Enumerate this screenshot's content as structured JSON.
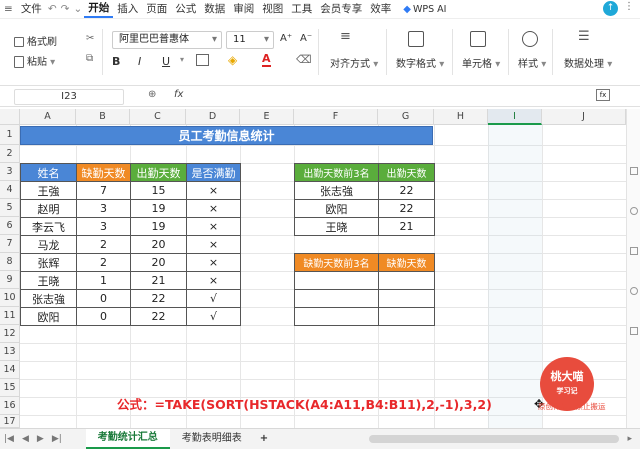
{
  "menu": {
    "file": "文件",
    "tabs": [
      "开始",
      "插入",
      "页面",
      "公式",
      "数据",
      "审阅",
      "视图",
      "工具",
      "会员专享",
      "效率"
    ],
    "wps_ai": "WPS AI"
  },
  "toolbar": {
    "format_painter": "格式刷",
    "paste": "粘贴",
    "font_name": "阿里巴巴普惠体",
    "font_size": "11",
    "bold": "B",
    "italic": "I",
    "underline": "U",
    "align": "对齐方式",
    "number_format": "数字格式",
    "cell": "单元格",
    "style": "样式",
    "data_process": "数据处理"
  },
  "formula_bar": {
    "cell_ref": "I23",
    "fx": "fx"
  },
  "columns": [
    "A",
    "B",
    "C",
    "D",
    "E",
    "F",
    "G",
    "H",
    "I",
    "J"
  ],
  "rows": [
    "1",
    "2",
    "3",
    "4",
    "5",
    "6",
    "7",
    "8",
    "9",
    "10",
    "11",
    "12",
    "13",
    "14",
    "15",
    "16",
    "17"
  ],
  "sheet": {
    "title": "员工考勤信息统计",
    "main_headers": [
      "姓名",
      "缺勤天数",
      "出勤天数",
      "是否满勤"
    ],
    "records": [
      [
        "王強",
        "7",
        "15",
        "×"
      ],
      [
        "赵明",
        "3",
        "19",
        "×"
      ],
      [
        "李云飞",
        "3",
        "19",
        "×"
      ],
      [
        "马龙",
        "2",
        "20",
        "×"
      ],
      [
        "张辉",
        "2",
        "20",
        "×"
      ],
      [
        "王晓",
        "1",
        "21",
        "×"
      ],
      [
        "张志強",
        "0",
        "22",
        "√"
      ],
      [
        "欧阳",
        "0",
        "22",
        "√"
      ]
    ],
    "top3_attend_headers": [
      "出勤天数前3名",
      "出勤天数"
    ],
    "top3_attend": [
      [
        "张志強",
        "22"
      ],
      [
        "欧阳",
        "22"
      ],
      [
        "王晓",
        "21"
      ]
    ],
    "top3_absent_headers": [
      "缺勤天数前3名",
      "缺勤天数"
    ],
    "formula_text": "公式：=TAKE(SORT(HSTACK(A4:A11,B4:B11),2,-1),3,2)"
  },
  "watermark": {
    "name": "桃大喵",
    "sub": "学习记",
    "note": "原创作品，禁止搬运"
  },
  "sheet_tabs": [
    "考勤统计汇总",
    "考勤表明细表"
  ],
  "add_sheet": "+"
}
